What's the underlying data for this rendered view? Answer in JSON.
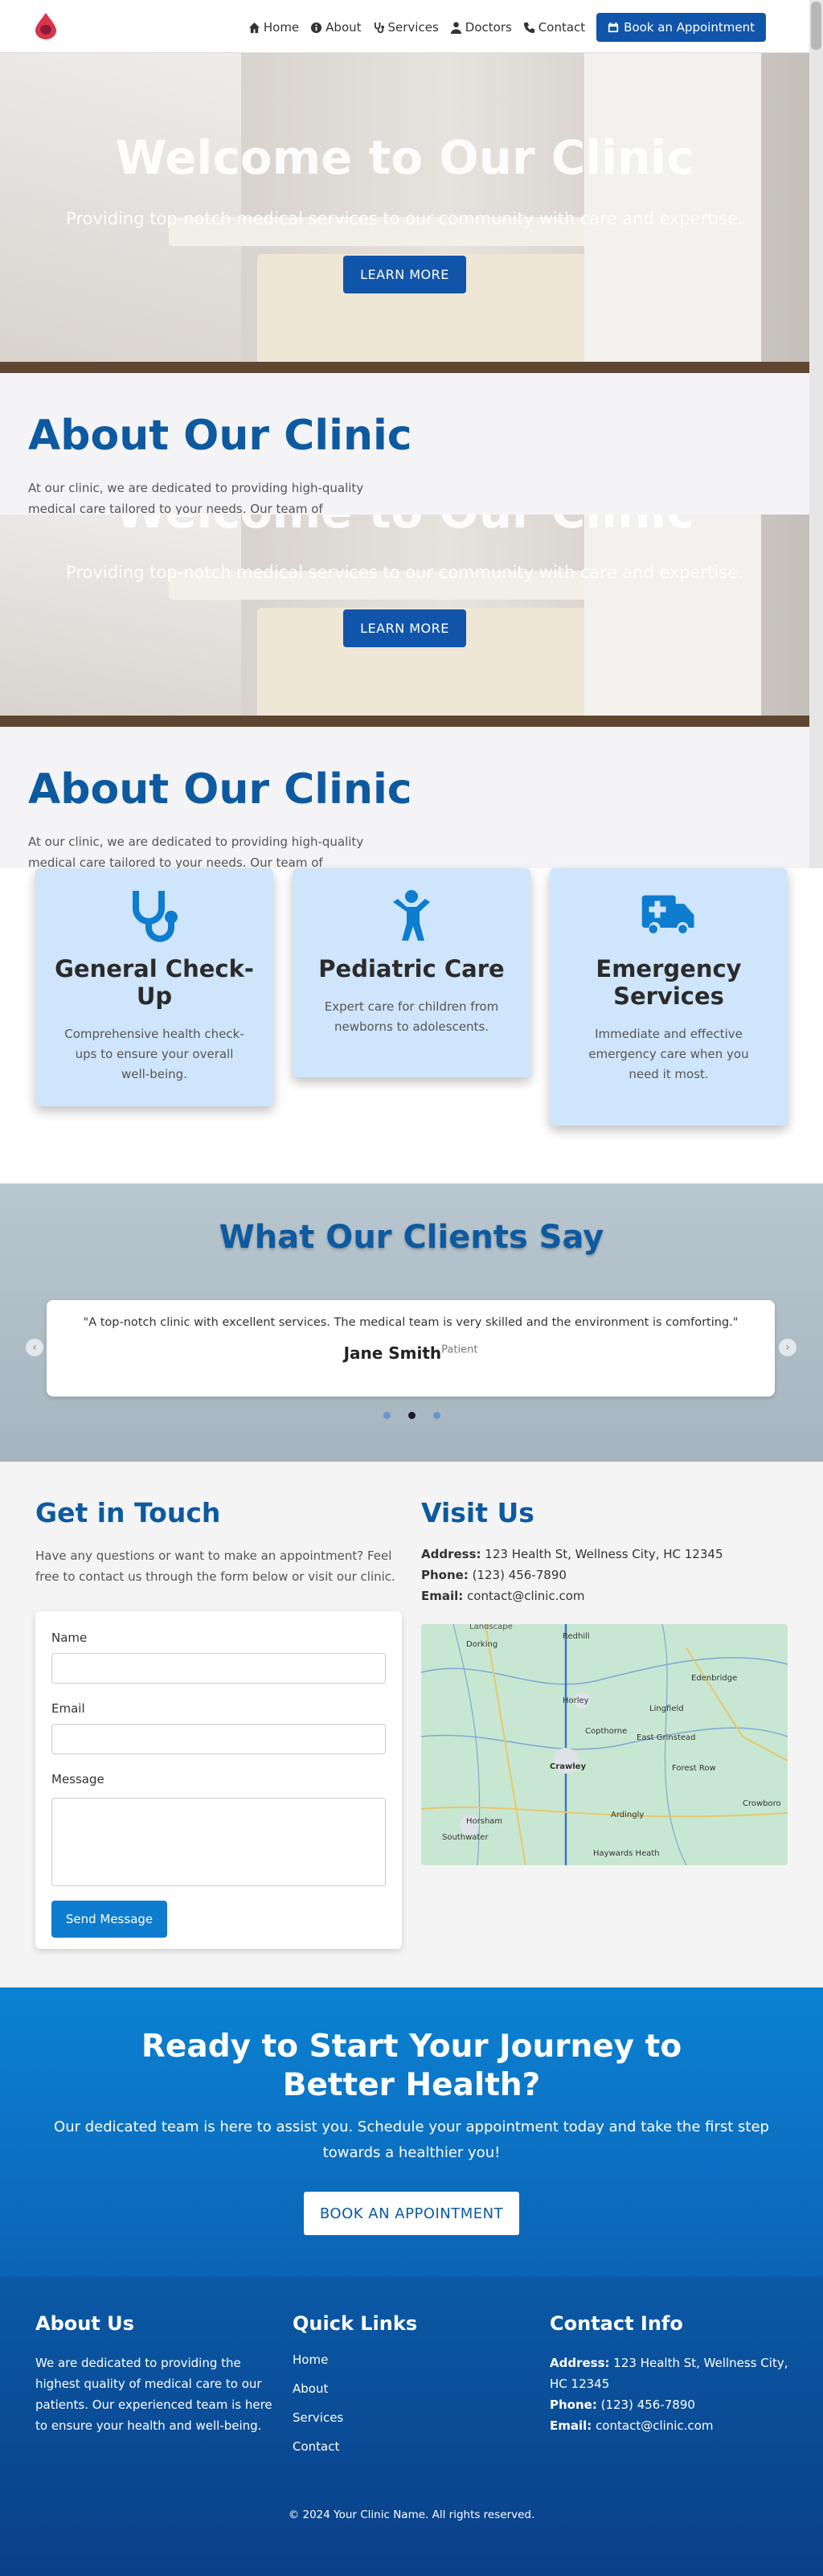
{
  "nav": {
    "items": [
      {
        "label": "Home",
        "icon": "home-icon"
      },
      {
        "label": "About",
        "icon": "info-icon"
      },
      {
        "label": "Services",
        "icon": "stethoscope-icon"
      },
      {
        "label": "Doctors",
        "icon": "doctor-icon"
      },
      {
        "label": "Contact",
        "icon": "phone-icon"
      }
    ],
    "book_label": "Book an Appointment"
  },
  "hero": {
    "title": "Welcome to Our Clinic",
    "subtitle": "Providing top-notch medical services to our community with care and expertise.",
    "button": "LEARN MORE"
  },
  "about": {
    "title": "About Our Clinic",
    "text": "At our clinic, we are dedicated to providing high-quality medical care tailored to your needs. Our team of experienced"
  },
  "services": [
    {
      "title": "General Check-Up",
      "text": "Comprehensive health check-ups to ensure your overall well-being.",
      "icon": "stethoscope-icon"
    },
    {
      "title": "Pediatric Care",
      "text": "Expert care for children from newborns to adolescents.",
      "icon": "child-icon"
    },
    {
      "title": "Emergency Services",
      "text": "Immediate and effective emergency care when you need it most.",
      "icon": "ambulance-icon"
    }
  ],
  "testimonials": {
    "title": "What Our Clients Say",
    "quote": "\"A top-notch clinic with excellent services. The medical team is very skilled and the environment is comforting.\"",
    "name": "Jane Smith",
    "role": "Patient",
    "active_slide": 2,
    "slide_count": 3
  },
  "contact": {
    "title": "Get in Touch",
    "text": "Have any questions or want to make an appointment? Feel free to contact us through the form below or visit our clinic.",
    "name_label": "Name",
    "email_label": "Email",
    "message_label": "Message",
    "send_label": "Send Message",
    "visit_title": "Visit Us",
    "address_label": "Address:",
    "address": "123 Health St, Wellness City, HC 12345",
    "phone_label": "Phone:",
    "phone": "(123) 456-7890",
    "email_info_label": "Email:",
    "email": "contact@clinic.com",
    "map_places": [
      "Dorking",
      "Redhill",
      "Horley",
      "Edenbridge",
      "Copthorne",
      "East Grinstead",
      "Lingfield",
      "Crawley",
      "Forest Row",
      "Horsham",
      "Ardingly",
      "Crowboro",
      "Southwater",
      "Haywards Heath",
      "Landscape"
    ]
  },
  "cta": {
    "title": "Ready to Start Your Journey to Better Health?",
    "text": "Our dedicated team is here to assist you. Schedule your appointment today and take the first step towards a healthier you!",
    "button": "BOOK AN APPOINTMENT"
  },
  "footer": {
    "about_title": "About Us",
    "about_text": "We are dedicated to providing the highest quality of medical care to our patients. Our experienced team is here to ensure your health and well-being.",
    "links_title": "Quick Links",
    "links": [
      "Home",
      "About",
      "Services",
      "Contact"
    ],
    "contact_title": "Contact Info",
    "address_label": "Address:",
    "address": "123 Health St, Wellness City, HC 12345",
    "phone_label": "Phone:",
    "phone": "(123) 456-7890",
    "email_label": "Email:",
    "email": "contact@clinic.com",
    "copyright": "© 2024 Your Clinic Name. All rights reserved."
  },
  "colors": {
    "primary": "#1155aa",
    "accent": "#0e7ccf",
    "card": "#cfe5fc"
  }
}
